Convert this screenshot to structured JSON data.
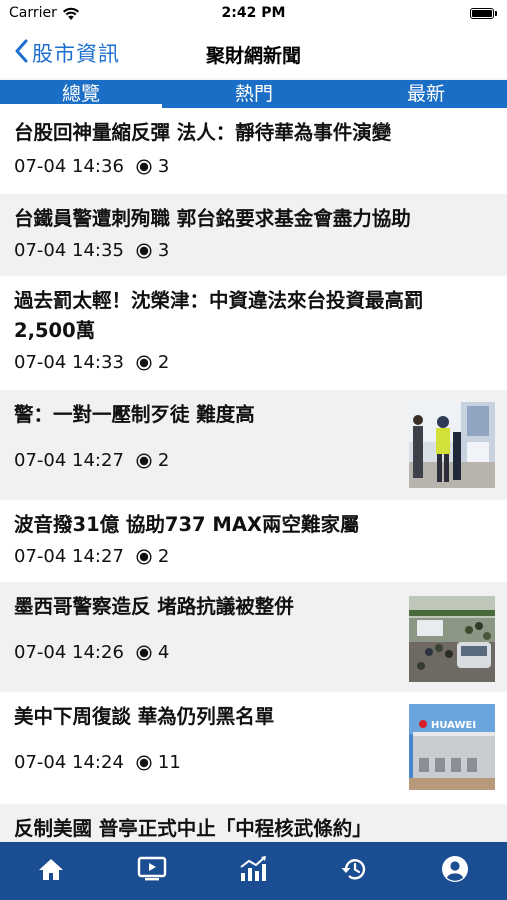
{
  "status_bar": {
    "carrier": "Carrier",
    "time": "2:42 PM"
  },
  "nav": {
    "back_label": "股市資訊",
    "title": "聚財網新聞"
  },
  "tabs": [
    {
      "label": "總覽",
      "selected": true
    },
    {
      "label": "熱門",
      "selected": false
    },
    {
      "label": "最新",
      "selected": false
    }
  ],
  "news": [
    {
      "title": "台股回神量縮反彈 法人：靜待華為事件演變",
      "time": "07-04 14:36",
      "views": "3"
    },
    {
      "title": "台鐵員警遭刺殉職 郭台銘要求基金會盡力協助",
      "time": "07-04 14:35",
      "views": "3"
    },
    {
      "title_line1": "過去罰太輕！沈榮津：中資違法來台投資最高罰",
      "title_line2": "2,500萬",
      "time": "07-04 14:33",
      "views": "2"
    },
    {
      "title": "警：一對一壓制歹徒 難度高",
      "time": "07-04 14:27",
      "views": "2",
      "thumbnail": "police-station-photo"
    },
    {
      "title": "波音撥31億 協助737 MAX兩空難家屬",
      "time": "07-04 14:27",
      "views": "2"
    },
    {
      "title": "墨西哥警察造反 堵路抗議被整併",
      "time": "07-04 14:26",
      "views": "4",
      "thumbnail": "street-protest-photo"
    },
    {
      "title": "美中下周復談 華為仍列黑名單",
      "time": "07-04 14:24",
      "views": "11",
      "thumbnail": "huawei-building-photo",
      "thumbnail_text": "HUAWEI"
    },
    {
      "title": "反制美國 普亭正式中止「中程核武條約」"
    }
  ],
  "bottom_tabs": [
    {
      "icon": "home-icon"
    },
    {
      "icon": "video-icon"
    },
    {
      "icon": "chart-icon"
    },
    {
      "icon": "history-icon"
    },
    {
      "icon": "account-icon"
    }
  ],
  "colors": {
    "accent": "#1b6ec6",
    "bottom_bar": "#1b4d93",
    "back_link": "#1c6ecf"
  }
}
